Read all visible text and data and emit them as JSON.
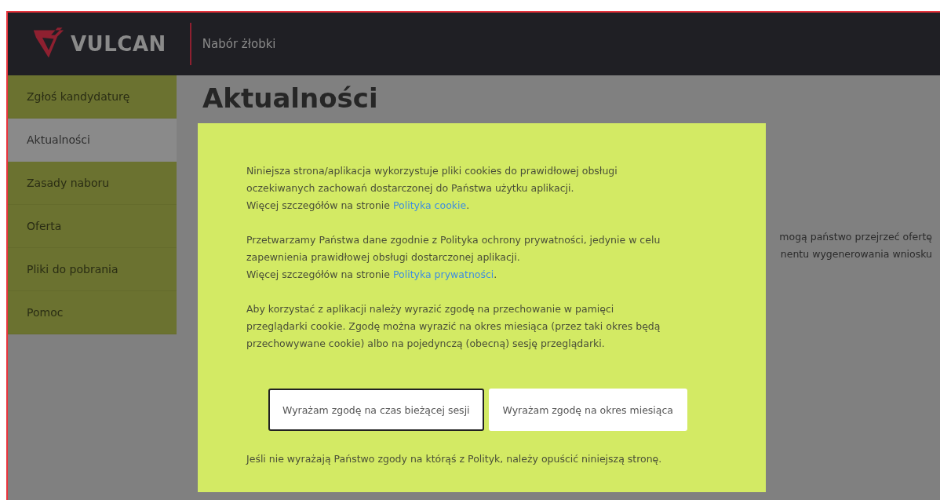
{
  "header": {
    "logo_text": "VULCAN",
    "app_title": "Nabór żłobki"
  },
  "sidebar": {
    "items": [
      {
        "label": "Zgłoś kandydaturę",
        "selected": false
      },
      {
        "label": "Aktualności",
        "selected": true
      },
      {
        "label": "Zasady naboru",
        "selected": false
      },
      {
        "label": "Oferta",
        "selected": false
      },
      {
        "label": "Pliki do pobrania",
        "selected": false
      },
      {
        "label": "Pomoc",
        "selected": false
      }
    ]
  },
  "content": {
    "heading": "Aktualności",
    "lines": [
      "mogą państwo przejrzeć ofertę",
      "nentu wygenerowania wniosku"
    ]
  },
  "cookie_dialog": {
    "paragraphs": [
      {
        "lines": [
          "Niniejsza strona/aplikacja wykorzystuje pliki cookies do prawidłowej obsługi",
          "oczekiwanych zachowań dostarczonej do Państwa użytku aplikacji."
        ],
        "link_prefix": "Więcej szczegółów na stronie ",
        "link": "Polityka cookie",
        "link_suffix": "."
      },
      {
        "lines": [
          "Przetwarzamy Państwa dane zgodnie z Polityka ochrony prywatności, jedynie w celu",
          "zapewnienia prawidłowej obsługi dostarczonej aplikacji."
        ],
        "link_prefix": "Więcej szczegółów na stronie ",
        "link": "Polityka prywatności",
        "link_suffix": "."
      },
      {
        "lines": [
          "Aby korzystać z aplikacji należy wyrazić zgodę na przechowanie w pamięci",
          "przeglądarki cookie. Zgodę można wyrazić na okres miesiąca (przez taki okres będą",
          "przechowywane cookie) albo na pojedynczą (obecną) sesję przeglądarki."
        ]
      }
    ],
    "buttons": [
      {
        "label": "Wyrażam zgodę na czas bieżącej sesji",
        "focused": true
      },
      {
        "label": "Wyrażam zgodę na okres miesiąca",
        "focused": false
      }
    ],
    "footer_note": "Jeśli nie wyrażają Państwo zgody na którąś z Polityk, należy opuścić niniejszą stronę."
  }
}
